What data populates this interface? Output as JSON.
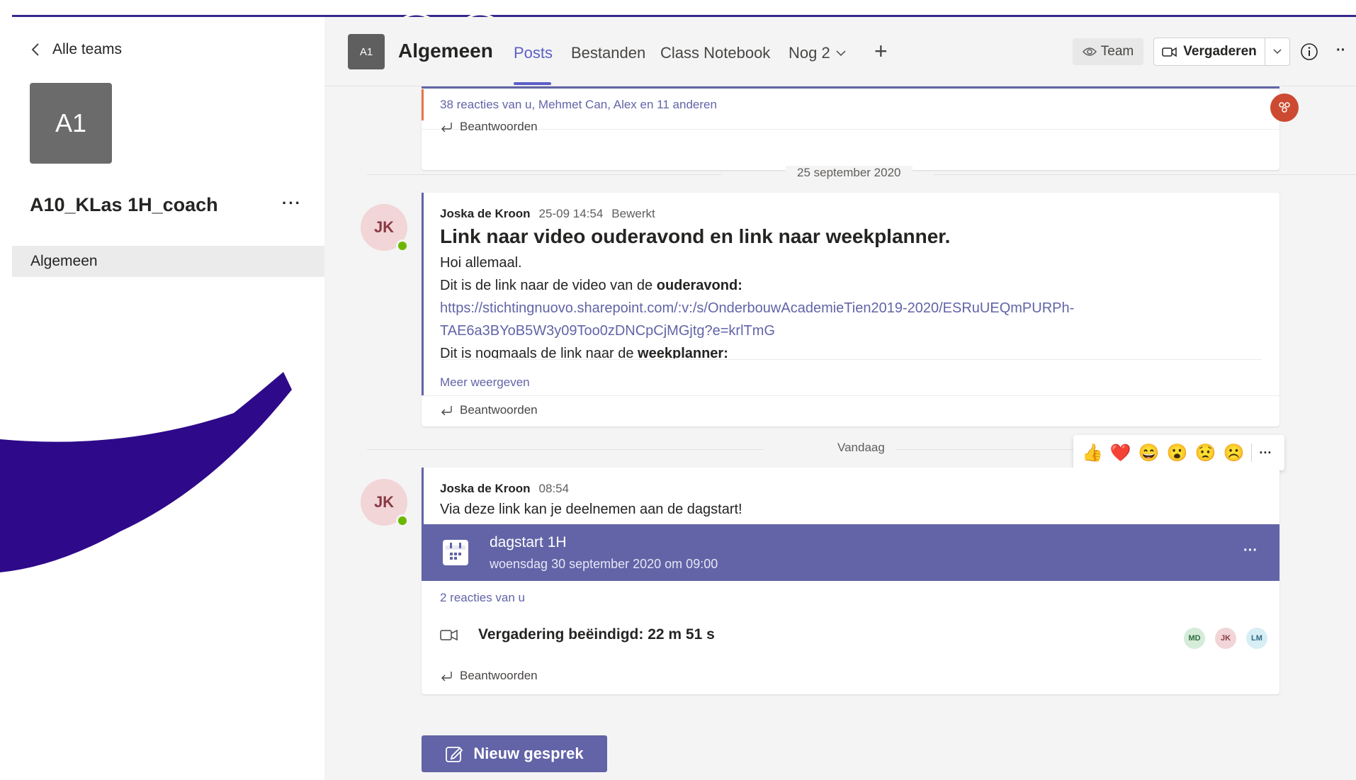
{
  "colors": {
    "accent": "#6264a7",
    "sidebar_selected": "#ebebeb",
    "presence": "#6bb700",
    "swoosh": "#2e0a8a"
  },
  "sidebar": {
    "back_label": "Alle teams",
    "team_tile": "A1",
    "team_name": "A10_KLas 1H_coach",
    "more_label": "···",
    "channels": [
      {
        "label": "Algemeen"
      }
    ]
  },
  "header": {
    "channel_icon": "A1",
    "channel_title": "Algemeen",
    "tabs": [
      {
        "label": "Posts",
        "active": true
      },
      {
        "label": "Bestanden"
      },
      {
        "label": "Class Notebook"
      },
      {
        "label": "Nog 2"
      }
    ],
    "add_tab": "+",
    "team_button": "Team",
    "meet_button": "Vergaderen",
    "more_label": "··"
  },
  "messages": {
    "first": {
      "reactions": "38 reacties van u, Mehmet Can, Alex en 11 anderen",
      "reply": "Beantwoorden"
    },
    "date_divider_1": "25 september 2020",
    "second": {
      "avatar": "JK",
      "author": "Joska de Kroon",
      "time": "25-09 14:54",
      "edited": "Bewerkt",
      "title": "Link naar video ouderavond en link naar weekplanner.",
      "line1": "Hoi allemaal.",
      "line2_prefix": "Dit is de link naar de video van de ",
      "line2_bold": "ouderavond:",
      "link_line1": "https://stichtingnuovo.sharepoint.com/:v:/s/OnderbouwAcademieTien2019-2020/ESRuUEQmPURPh-",
      "link_line2": "TAE6a3BYoB5W3y09Too0zDNCpCjMGjtg?e=krlTmG",
      "line3_prefix": "Dit is nogmaals de link naar de ",
      "line3_bold": "weekplanner:",
      "more": "Meer weergeven",
      "reply": "Beantwoorden"
    },
    "date_divider_2": "Vandaag",
    "reaction_bar": [
      "👍",
      "❤️",
      "😄",
      "😮",
      "😟",
      "☹️"
    ],
    "reaction_more": "···",
    "third": {
      "avatar": "JK",
      "author": "Joska de Kroon",
      "time": "08:54",
      "text": "Via deze link kan je deelnemen aan de dagstart!",
      "meeting_title": "dagstart 1H",
      "meeting_date": "woensdag 30 september 2020 om 09:00",
      "meeting_more": "···",
      "reactions": "2 reacties van u",
      "ended": "Vergadering beëindigd: 22 m 51 s",
      "participants": [
        "MD",
        "JK",
        "LM"
      ],
      "reply": "Beantwoorden"
    }
  },
  "new_conversation": "Nieuw gesprek"
}
